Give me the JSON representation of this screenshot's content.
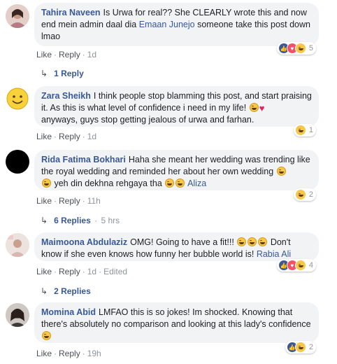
{
  "comments": [
    {
      "author": "Tahira Naveen",
      "text_parts": [
        "Is Urwa for real?? She CLEARLY wrote this and now end mein admin daal dia ",
        " someone take this post down lmao"
      ],
      "mention": "Emaan Junejo",
      "reaction_count": "5",
      "actions": {
        "like": "Like",
        "reply": "Reply",
        "time": "1d"
      },
      "replies": "1 Reply"
    },
    {
      "author": "Zara Sheikh",
      "text": "I think people stop blamming this post, and start praising it. As this is what level of confidence i need in my life!",
      "text2": "anyways, guys stop getting jealous of urwa and farhan.",
      "reaction_count": "1",
      "actions": {
        "like": "Like",
        "reply": "Reply",
        "time": "1d"
      }
    },
    {
      "author": "Rida Fatima Bokhari",
      "text": "Haha she meant her wedding was trending like the royal wedding and reminded her about her own wedding",
      "text2": "yeh din dekhna rehgaya tha",
      "mention": "Aliza",
      "reaction_count": "2",
      "actions": {
        "like": "Like",
        "reply": "Reply",
        "time": "11h"
      },
      "replies": "6 Replies",
      "replies_time": "5 hrs"
    },
    {
      "author": "Maimoona Abdulaziz",
      "text": "OMG! Going to have a fit!!!",
      "text2": "Don't know if she even knows how funny her bubble world is!",
      "mention": "Rabia Ali",
      "reaction_count": "4",
      "actions": {
        "like": "Like",
        "reply": "Reply",
        "time": "1d",
        "edited": "Edited"
      },
      "replies": "2 Replies"
    },
    {
      "author": "Momina Abid",
      "text": "LMFAO this is so jokes! Im shocked. Knowing that there's absolutely no comparison and looking at this lady's confidence",
      "reaction_count": "2",
      "actions": {
        "like": "Like",
        "reply": "Reply",
        "time": "19h"
      }
    }
  ]
}
